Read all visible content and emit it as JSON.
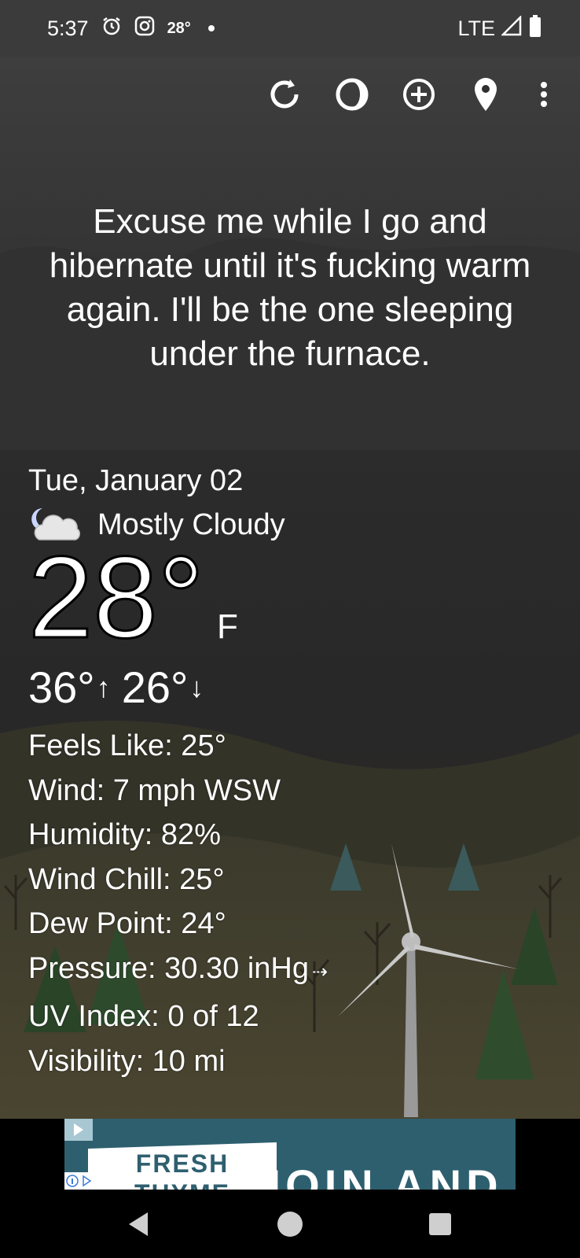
{
  "status_bar": {
    "time": "5:37",
    "temp_badge": "28°",
    "network": "LTE"
  },
  "toolbar": {
    "icons": [
      "refresh-icon",
      "theme-icon",
      "add-location-icon",
      "location-pin-icon",
      "more-vert-icon"
    ]
  },
  "quote": "Excuse me while I go and hibernate until it's fucking warm again. I'll be the one sleeping under the furnace.",
  "weather": {
    "date": "Tue, January 02",
    "condition": "Mostly Cloudy",
    "temperature": "28°",
    "unit": "F",
    "high": "36°",
    "low": "26°",
    "high_arrow": "↑",
    "low_arrow": "↓",
    "details": {
      "feels_like": "Feels Like:  25°",
      "wind": "Wind:  7 mph WSW",
      "humidity": "Humidity:  82%",
      "wind_chill": "Wind Chill:  25°",
      "dew_point": "Dew Point:  24°",
      "pressure": "Pressure:  30.30 inHg",
      "pressure_trend": "⇢",
      "uv_index": "UV Index:  0 of 12",
      "visibility": "Visibility:  10 mi"
    }
  },
  "ad": {
    "brand": "FRESH THYME",
    "headline": "JOIN AND"
  },
  "colors": {
    "statusbar": "#3b3b3b",
    "sky": "#2a2a2a",
    "ad_bg": "#2e5f6f"
  }
}
